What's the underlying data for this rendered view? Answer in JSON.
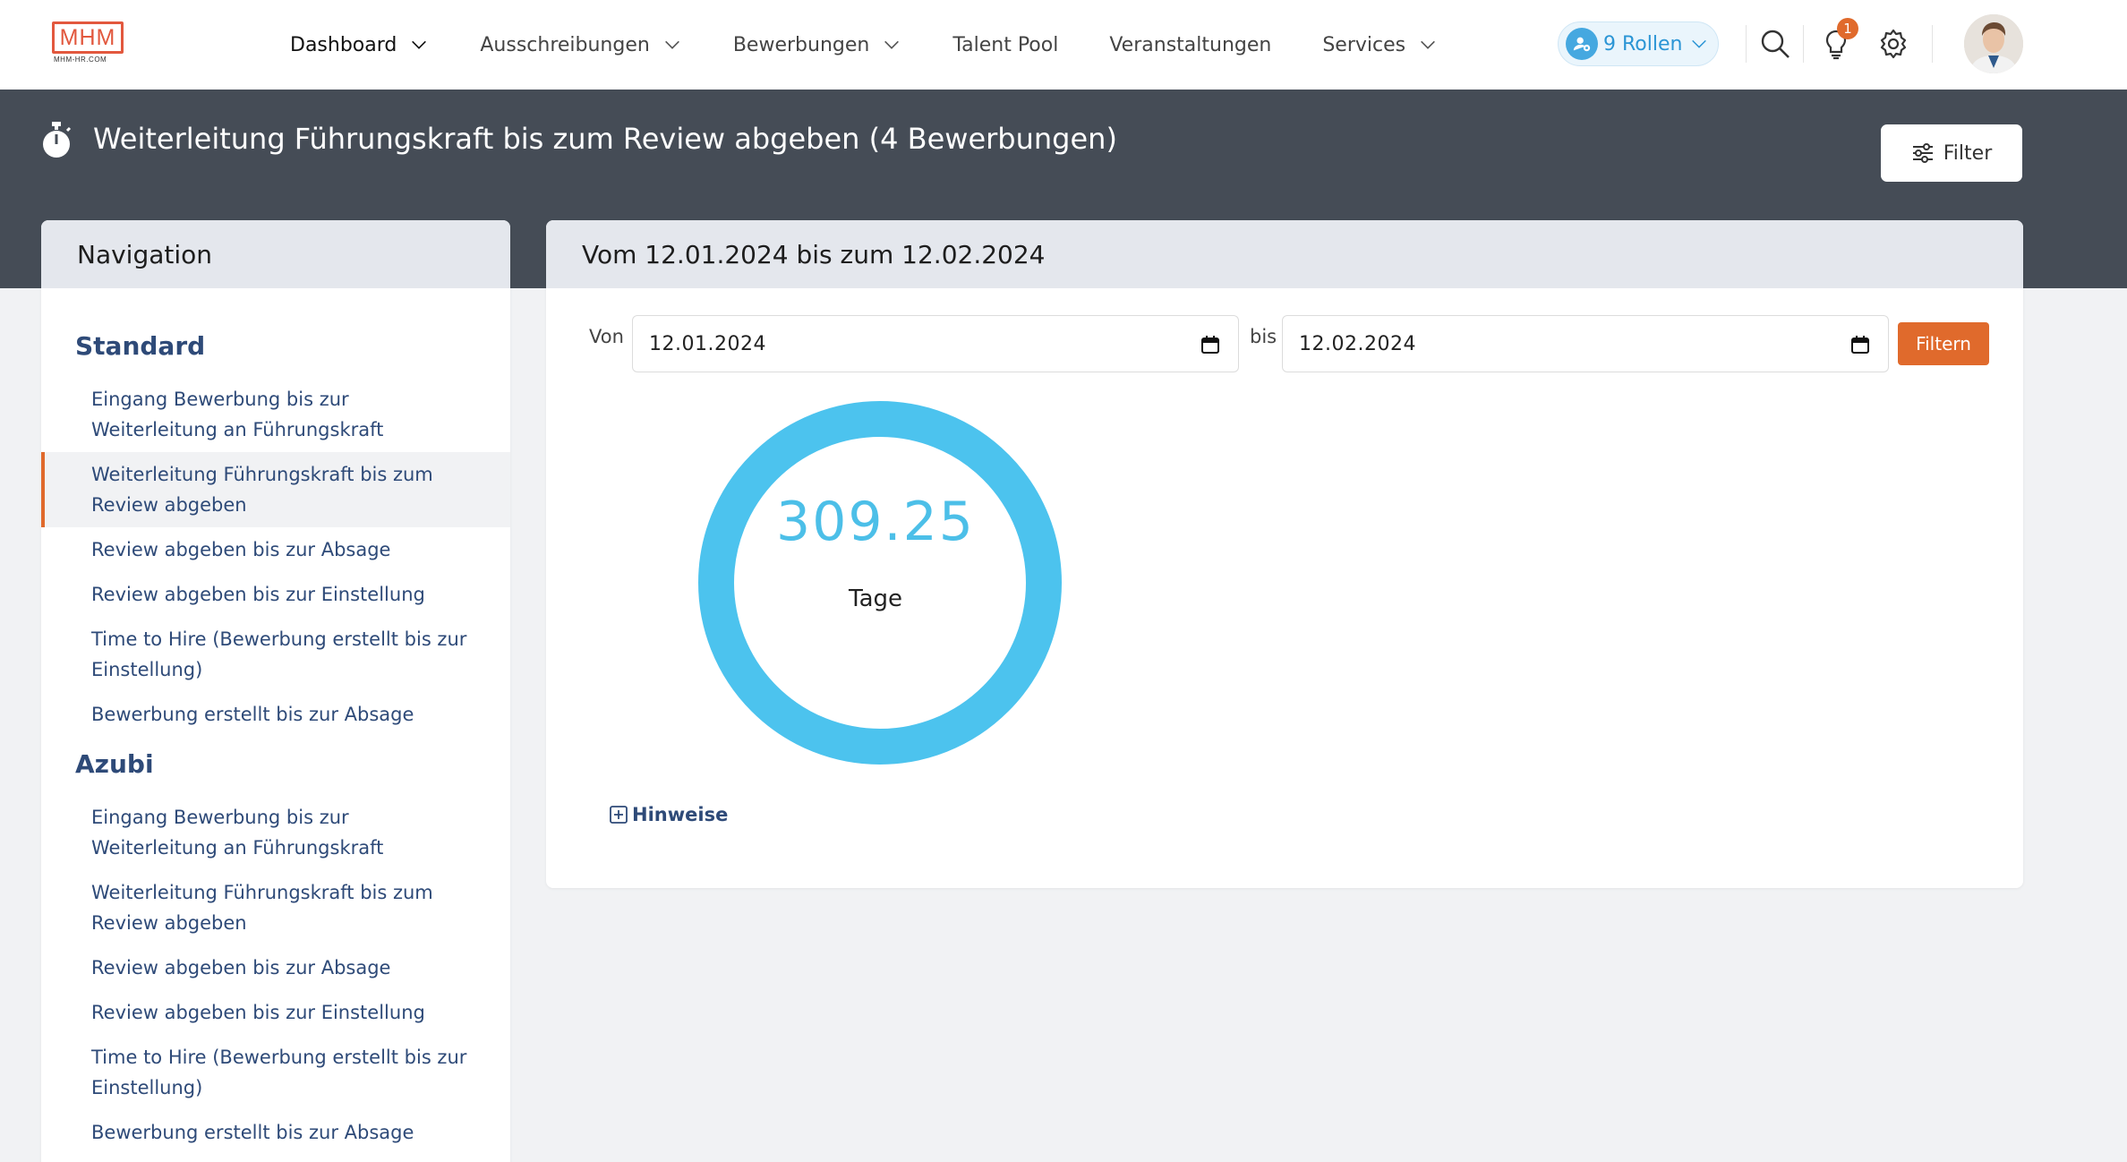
{
  "brand": {
    "logo_text": "MHM",
    "logo_sub": "MHM-HR.COM",
    "accent": "#e06a2c"
  },
  "nav": {
    "items": [
      {
        "label": "Dashboard",
        "has_dropdown": true,
        "active": true
      },
      {
        "label": "Ausschreibungen",
        "has_dropdown": true
      },
      {
        "label": "Bewerbungen",
        "has_dropdown": true
      },
      {
        "label": "Talent Pool",
        "has_dropdown": false
      },
      {
        "label": "Veranstaltungen",
        "has_dropdown": false
      },
      {
        "label": "Services",
        "has_dropdown": true
      }
    ],
    "roles_label": "9 Rollen",
    "notification_count": "1",
    "icons": [
      "search-icon",
      "lightbulb-icon",
      "gear-icon"
    ]
  },
  "header": {
    "title": "Weiterleitung Führungskraft bis zum Review abgeben (4 Bewerbungen)",
    "filter_label": "Filter",
    "band_color": "#454c56"
  },
  "navigation": {
    "title": "Navigation",
    "sections": [
      {
        "title": "Standard",
        "links": [
          {
            "lines": [
              "Eingang Bewerbung bis zur",
              "Weiterleitung an Führungskraft"
            ]
          },
          {
            "lines": [
              "Weiterleitung Führungskraft bis zum",
              "Review abgeben"
            ],
            "active": true
          },
          {
            "lines": [
              "Review abgeben bis zur Absage"
            ]
          },
          {
            "lines": [
              "Review abgeben bis zur Einstellung"
            ]
          },
          {
            "lines": [
              "Time to Hire (Bewerbung erstellt bis zur",
              "Einstellung)"
            ]
          },
          {
            "lines": [
              "Bewerbung erstellt bis zur Absage"
            ]
          }
        ]
      },
      {
        "title": "Azubi",
        "links": [
          {
            "lines": [
              "Eingang Bewerbung bis zur",
              "Weiterleitung an Führungskraft"
            ]
          },
          {
            "lines": [
              "Weiterleitung Führungskraft bis zum",
              "Review abgeben"
            ]
          },
          {
            "lines": [
              "Review abgeben bis zur Absage"
            ]
          },
          {
            "lines": [
              "Review abgeben bis zur Einstellung"
            ]
          },
          {
            "lines": [
              "Time to Hire (Bewerbung erstellt bis zur",
              "Einstellung)"
            ]
          },
          {
            "lines": [
              "Bewerbung erstellt bis zur Absage"
            ]
          }
        ]
      }
    ]
  },
  "main": {
    "title": "Vom 12.01.2024 bis zum 12.02.2024",
    "from_label": "Von",
    "from_value": "12.01.2024",
    "to_label": "bis",
    "to_value": "12.02.2024",
    "filter_button": "Filtern",
    "metric_value": "309.25",
    "metric_unit": "Tage",
    "metric_color": "#4cc3ee",
    "hints_label": "Hinweise"
  }
}
